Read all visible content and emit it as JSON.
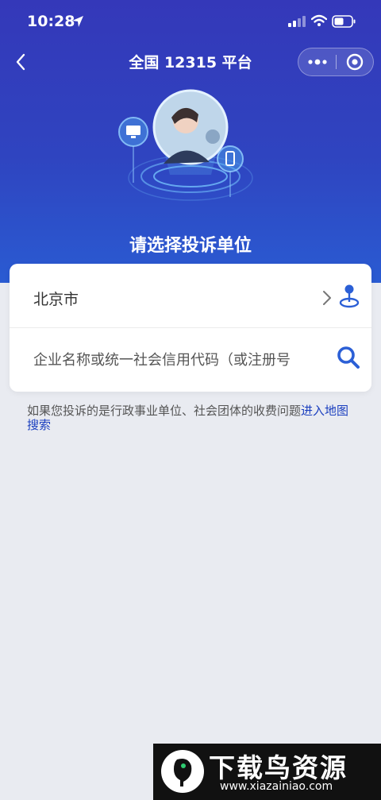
{
  "status_bar": {
    "time": "10:28"
  },
  "nav": {
    "title": "全国 12315 平台"
  },
  "hero": {
    "heading": "请选择投诉单位"
  },
  "form": {
    "region_value": "北京市",
    "search_placeholder": "企业名称或统一社会信用代码（或注册号"
  },
  "note": {
    "text": "如果您投诉的是行政事业单位、社会团体的收费问题",
    "link": "进入地图搜索"
  },
  "watermark": {
    "title": "下载鸟资源",
    "url": "www.xiazainiao.com"
  },
  "colors": {
    "primary": "#3438b9",
    "link": "#1b3fbf",
    "icon": "#2b5fd6",
    "background": "#e9ebf1"
  }
}
